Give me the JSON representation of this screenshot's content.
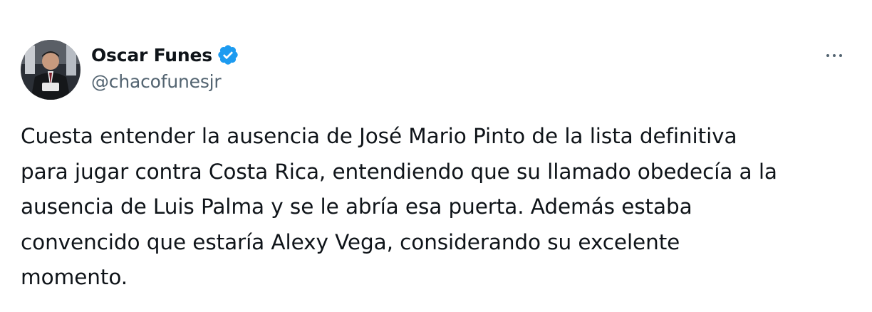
{
  "author": {
    "display_name": "Oscar Funes",
    "handle": "@chacofunesjr",
    "verified": true,
    "verified_color": "#1d9bf0",
    "avatar_icon": "profile-photo"
  },
  "actions": {
    "more_icon": "more-horizontal-icon"
  },
  "tweet": {
    "lines": [
      "Cuesta entender la ausencia de José Mario Pinto de la lista definitiva",
      "para jugar contra Costa Rica, entendiendo que su llamado obedecía a la",
      "ausencia de Luis Palma y se le abría esa puerta. Además estaba",
      "convencido que estaría Alexy Vega, considerando su excelente",
      "momento."
    ]
  },
  "colors": {
    "text_primary": "#0f1419",
    "text_secondary": "#536471",
    "background": "#ffffff"
  }
}
